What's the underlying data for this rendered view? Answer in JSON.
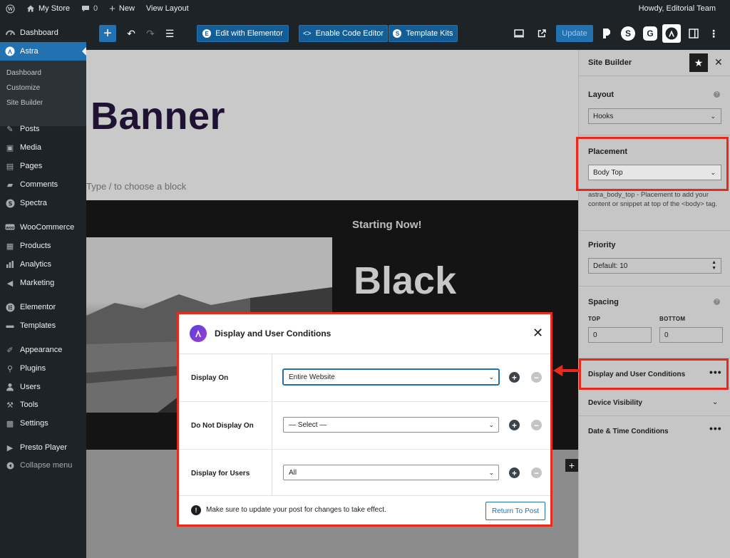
{
  "admin_bar": {
    "site_name": "My Store",
    "comments_count": "0",
    "new_label": "New",
    "view_layout": "View Layout",
    "greeting": "Howdy, Editorial Team"
  },
  "sidebar": {
    "dashboard": "Dashboard",
    "astra": "Astra",
    "astra_sub": [
      "Dashboard",
      "Customize",
      "Site Builder"
    ],
    "items": [
      "Posts",
      "Media",
      "Pages",
      "Comments",
      "Spectra",
      "WooCommerce",
      "Products",
      "Analytics",
      "Marketing",
      "Elementor",
      "Templates",
      "Appearance",
      "Plugins",
      "Users",
      "Tools",
      "Settings",
      "Presto Player"
    ],
    "collapse": "Collapse menu"
  },
  "toolbar": {
    "edit_elementor": "Edit with Elementor",
    "enable_code_editor": "Enable Code Editor",
    "template_kits": "Template Kits",
    "update": "Update"
  },
  "canvas": {
    "banner_title": "Banner",
    "type_hint": "Type / to choose a block",
    "starting_now": "Starting Now!",
    "black_word": "Black"
  },
  "right_panel": {
    "title": "Site Builder",
    "layout_label": "Layout",
    "layout_value": "Hooks",
    "placement_label": "Placement",
    "placement_value": "Body Top",
    "placement_desc": "astra_body_top - Placement to add your content or snippet at top of the <body> tag.",
    "priority_label": "Priority",
    "priority_value": "Default: 10",
    "spacing_label": "Spacing",
    "top_label": "TOP",
    "bottom_label": "BOTTOM",
    "top_value": "0",
    "bottom_value": "0",
    "display_conditions": "Display and User Conditions",
    "device_visibility": "Device Visibility",
    "date_time": "Date & Time Conditions"
  },
  "modal": {
    "title": "Display and User Conditions",
    "rows": [
      {
        "label": "Display On",
        "value": "Entire Website"
      },
      {
        "label": "Do Not Display On",
        "value": "— Select —"
      },
      {
        "label": "Display for Users",
        "value": "All"
      }
    ],
    "footer_note": "Make sure to update your post for changes to take effect.",
    "return_button": "Return To Post"
  },
  "colors": {
    "wp_blue": "#2271b1",
    "highlight_red": "#e8291c",
    "admin_dark": "#1d2327"
  }
}
